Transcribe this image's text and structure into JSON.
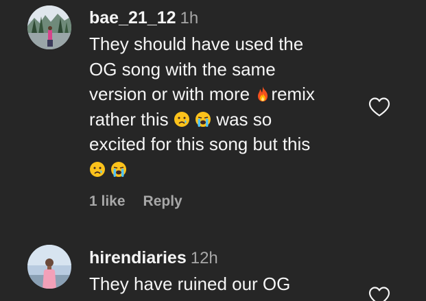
{
  "comments": [
    {
      "username": "bae_21_12",
      "time": "1h",
      "lines": [
        {
          "pre": "They should have used the"
        },
        {
          "pre": "OG song with the same"
        },
        {
          "pre": "version or with more ",
          "post": "remix"
        },
        {
          "pre": "rather this ",
          "mid": " ",
          "post": " was so"
        },
        {
          "pre": "excited for this song but this"
        },
        {
          "pre": ""
        }
      ],
      "emoji": [
        "fire-emoji",
        "crying-face-emoji",
        "loudly-crying-face-emoji"
      ],
      "likes": "1 like",
      "reply": "Reply",
      "like_icon": "heart-outline-icon"
    },
    {
      "username": "hirendiaries",
      "time": "12h",
      "lines": [
        {
          "pre": "They have ruined our OG"
        }
      ],
      "like_icon": "heart-outline-icon"
    }
  ],
  "colors": {
    "background": "#262626",
    "primary_text": "#f5f5f5",
    "secondary_text": "#a8a8a8"
  }
}
